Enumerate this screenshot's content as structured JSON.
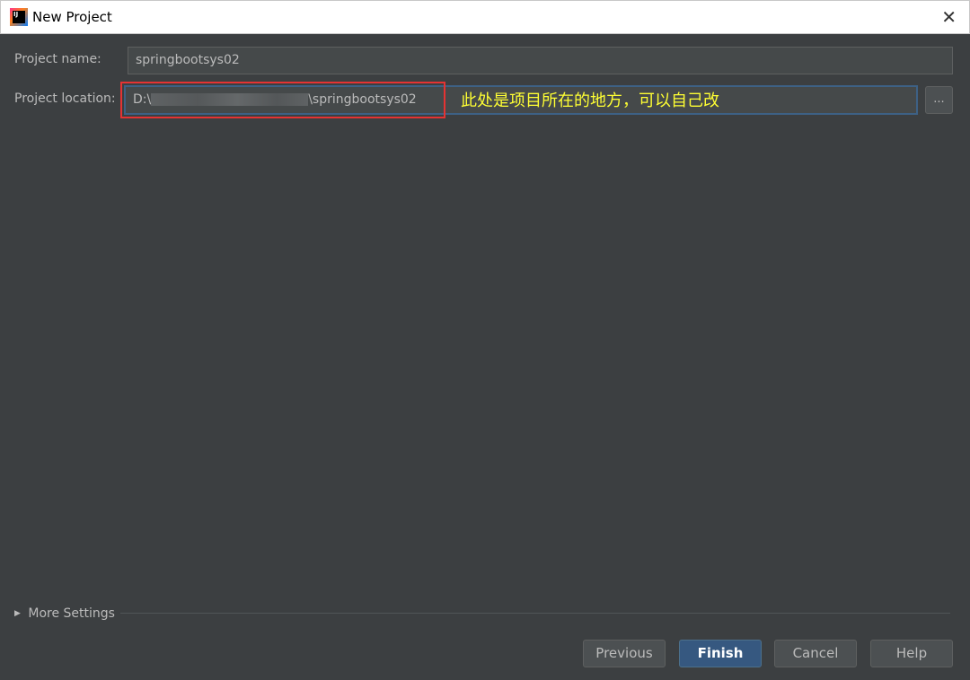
{
  "window": {
    "title": "New Project"
  },
  "form": {
    "project_name_label": "Project name:",
    "project_name_value": "springbootsys02",
    "project_location_label": "Project location:",
    "project_location_prefix": "D:\\",
    "project_location_suffix": "\\springbootsys02",
    "browse_label": "...",
    "annotation": "此处是项目所在的地方，可以自己改"
  },
  "more_settings": "More Settings",
  "buttons": {
    "previous": "Previous",
    "finish": "Finish",
    "cancel": "Cancel",
    "help": "Help"
  },
  "colors": {
    "background": "#3c3f41",
    "primary": "#365880",
    "annotation": "#ffff33",
    "highlight": "#e53333"
  }
}
